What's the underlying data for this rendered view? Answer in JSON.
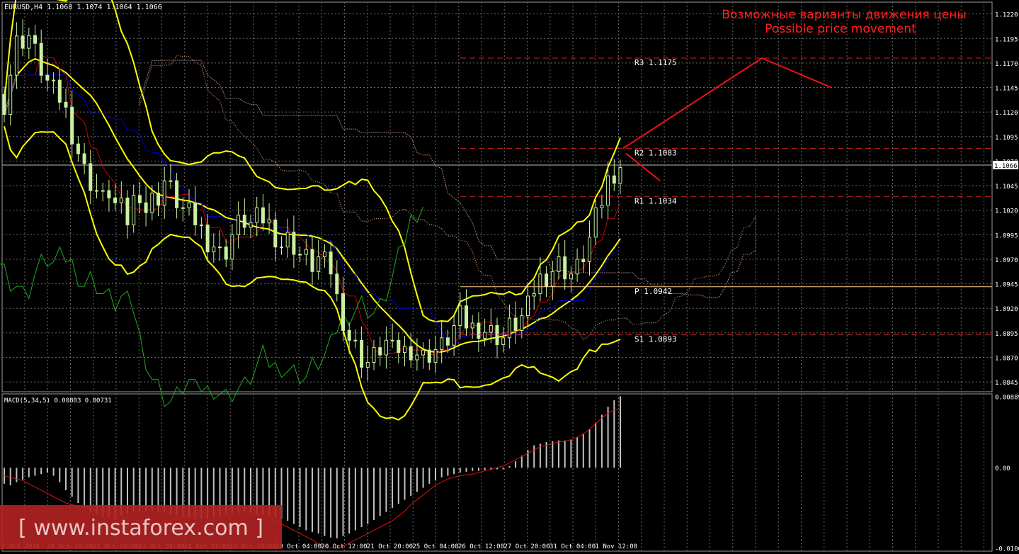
{
  "window": {
    "symbol_line": "EURUSD,H4  1.1068 1.1074 1.1064 1.1066",
    "title_ru": "Возможные варианты движения цены",
    "title_en": "Possible price movement",
    "watermark": "[ www.instaforex.com ]"
  },
  "colors": {
    "background": "#000000",
    "grid": "#6a6a6a",
    "candle": "#c8f0a0",
    "bollinger": "#ffff00",
    "kijun": "#0000cc",
    "tenkan": "#cc0000",
    "chikou": "#22aa22",
    "cloud": "#cccccc",
    "levels": "#cc2222",
    "pivot": "#ffcc88",
    "forecast": "#ee1111",
    "macd_hist": "#c0c0c0",
    "macd_signal": "#dd1111"
  },
  "chart_data": {
    "type": "candlestick",
    "price_axis": {
      "ticks": [
        "1.1220",
        "1.1195",
        "1.1170",
        "1.1145",
        "1.1120",
        "1.1095",
        "1.1070",
        "1.1045",
        "1.1020",
        "1.0995",
        "1.0970",
        "1.0945",
        "1.0920",
        "1.0895",
        "1.0870",
        "1.0845"
      ],
      "current_price": "1.1066"
    },
    "time_axis": [
      "7 Oct 2016",
      "10 Oct 12:00",
      "11 Oct 20:00",
      "13 Oct 04:00",
      "14 Oct 12:00",
      "17 Oct 20:00",
      "19 Oct 04:00",
      "20 Oct 12:00",
      "21 Oct 20:00",
      "25 Oct 04:00",
      "26 Oct 12:00",
      "27 Oct 20:00",
      "31 Oct 04:00",
      "1 Nov 12:00"
    ],
    "levels": [
      {
        "label": "R3 1.1175",
        "value": 1.1175
      },
      {
        "label": "R2 1.1083",
        "value": 1.1083
      },
      {
        "label": "R1 1.1034",
        "value": 1.1034
      },
      {
        "label": "P 1.0942",
        "value": 1.0942
      },
      {
        "label": "S1 1.0893",
        "value": 1.0893
      }
    ],
    "close_path": [
      1.113,
      1.116,
      1.119,
      1.1195,
      1.1198,
      1.118,
      1.1165,
      1.115,
      1.114,
      1.1135,
      1.112,
      1.11,
      1.108,
      1.106,
      1.105,
      1.104,
      1.103,
      1.104,
      1.1025,
      1.102,
      1.101,
      1.103,
      1.104,
      1.102,
      1.103,
      1.1035,
      1.105,
      1.104,
      1.103,
      1.102,
      1.1015,
      1.101,
      1.1,
      1.099,
      1.0985,
      1.0975,
      1.098,
      1.0995,
      1.1005,
      1.101,
      1.1005,
      1.101,
      1.1012,
      1.1005,
      1.0995,
      1.0985,
      1.099,
      1.0985,
      1.0975,
      1.097,
      1.0965,
      1.097,
      1.0965,
      1.096,
      1.093,
      1.091,
      1.089,
      1.088,
      1.087,
      1.0865,
      1.087,
      1.088,
      1.0885,
      1.0875,
      1.088,
      1.0876,
      1.088,
      1.0875,
      1.087,
      1.0875,
      1.0878,
      1.088,
      1.089,
      1.09,
      1.091,
      1.0905,
      1.09,
      1.0902,
      1.0898,
      1.0895,
      1.0893,
      1.089,
      1.09,
      1.0905,
      1.091,
      1.092,
      1.094,
      1.095,
      1.0955,
      1.096,
      1.0965,
      1.096,
      1.0955,
      1.096,
      1.0975,
      1.099,
      1.101,
      1.103,
      1.105,
      1.106,
      1.1066
    ],
    "forecast": {
      "up": [
        [
          1.1083,
          0
        ],
        [
          1.1175,
          1
        ],
        [
          1.1145,
          1.5
        ]
      ],
      "down": [
        [
          1.1078,
          0
        ],
        [
          1.105,
          0.5
        ]
      ]
    },
    "macd": {
      "label": "MACD(5,34,5) 0.00803 0.00731",
      "ticks": [
        "0.00889",
        "0.00",
        "-0.01002"
      ],
      "histogram": [
        -0.002,
        -0.0022,
        -0.0018,
        -0.0015,
        -0.0012,
        -0.001,
        -0.0008,
        -0.0006,
        -0.001,
        -0.0018,
        -0.0028,
        -0.0036,
        -0.0044,
        -0.005,
        -0.0055,
        -0.0058,
        -0.006,
        -0.0062,
        -0.0064,
        -0.006,
        -0.0058,
        -0.0056,
        -0.0055,
        -0.0054,
        -0.0054,
        -0.0055,
        -0.0056,
        -0.0058,
        -0.006,
        -0.0062,
        -0.0063,
        -0.0064,
        -0.0064,
        -0.0063,
        -0.0062,
        -0.006,
        -0.0058,
        -0.0057,
        -0.0056,
        -0.0056,
        -0.0056,
        -0.0057,
        -0.0058,
        -0.006,
        -0.0062,
        -0.0064,
        -0.0066,
        -0.007,
        -0.0074,
        -0.0078,
        -0.008,
        -0.0082,
        -0.0085,
        -0.0087,
        -0.0088,
        -0.0085,
        -0.0082,
        -0.0078,
        -0.0074,
        -0.007,
        -0.0065,
        -0.006,
        -0.0055,
        -0.005,
        -0.0045,
        -0.004,
        -0.0035,
        -0.003,
        -0.0025,
        -0.002,
        -0.0016,
        -0.0012,
        -0.001,
        -0.0008,
        -0.0006,
        -0.0005,
        -0.0004,
        -0.0004,
        -0.0003,
        -0.0003,
        -0.0002,
        -0.0002,
        0.0002,
        0.0008,
        0.0015,
        0.0022,
        0.0028,
        0.003,
        0.0032,
        0.0033,
        0.0034,
        0.0034,
        0.0035,
        0.0038,
        0.0042,
        0.0048,
        0.0056,
        0.0066,
        0.0076,
        0.0084,
        0.0089
      ],
      "signal": [
        -0.001,
        -0.0012,
        -0.0014,
        -0.0016,
        -0.002,
        -0.0024,
        -0.0028,
        -0.0032,
        -0.0036,
        -0.004,
        -0.0044,
        -0.0046,
        -0.0048,
        -0.005,
        -0.005,
        -0.0052,
        -0.0054,
        -0.0056,
        -0.0058,
        -0.006,
        -0.0062,
        -0.0064,
        -0.0066,
        -0.0068,
        -0.007,
        -0.007,
        -0.0068,
        -0.0066,
        -0.0064,
        -0.0062,
        -0.006,
        -0.0058,
        -0.0056,
        -0.0055,
        -0.0054,
        -0.0053,
        -0.0052,
        -0.0052,
        -0.0053,
        -0.0054,
        -0.0056,
        -0.0058,
        -0.006,
        -0.0063,
        -0.0066,
        -0.007,
        -0.0074,
        -0.0078,
        -0.0082,
        -0.0086,
        -0.009,
        -0.0095,
        -0.0098,
        -0.01,
        -0.01,
        -0.0098,
        -0.0094,
        -0.009,
        -0.0086,
        -0.0082,
        -0.0078,
        -0.0074,
        -0.007,
        -0.0066,
        -0.006,
        -0.0054,
        -0.0046,
        -0.004,
        -0.0034,
        -0.0028,
        -0.0022,
        -0.0018,
        -0.0014,
        -0.0012,
        -0.001,
        -0.0009,
        -0.0008,
        -0.0006,
        -0.0004,
        -0.0002,
        0.0,
        0.0002,
        0.0006,
        0.001,
        0.0014,
        0.0018,
        0.0022,
        0.0026,
        0.0028,
        0.003,
        0.0032,
        0.0033,
        0.0035,
        0.0038,
        0.0042,
        0.0048,
        0.0055,
        0.0062,
        0.0068,
        0.0072,
        0.0073
      ]
    }
  }
}
